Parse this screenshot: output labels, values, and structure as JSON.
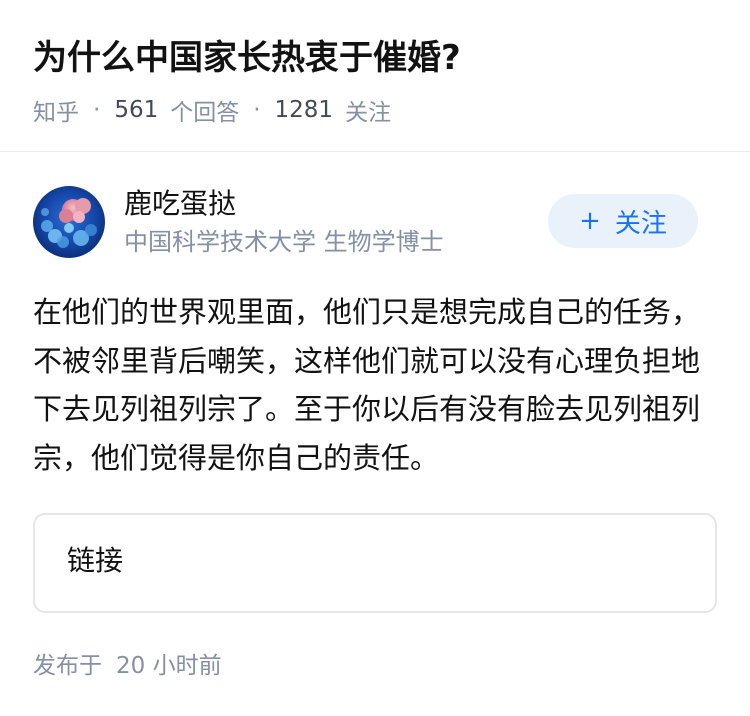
{
  "question": {
    "title": "为什么中国家长热衷于催婚?",
    "source": "知乎",
    "separator": "·",
    "answer_count": "561",
    "answer_label": "个回答",
    "follower_count": "1281",
    "follower_label": "关注"
  },
  "author": {
    "name": "鹿吃蛋挞",
    "bio": "中国科学技术大学 生物学博士",
    "avatar_icon": "molecule-avatar-icon",
    "follow_icon": "plus-icon",
    "follow_symbol": "+",
    "follow_label": "关注",
    "accent_color": "#1772f6"
  },
  "answer": {
    "content": "在他们的世界观里面，他们只是想完成自己的任务，不被邻里背后嘲笑，这样他们就可以没有心理负担地下去见列祖列宗了。至于你以后有没有脸去见列祖列宗，他们觉得是你自己的责任。"
  },
  "link_card": {
    "label": "链接"
  },
  "footer": {
    "published_label": "发布于",
    "published_time": "20 小时前"
  }
}
